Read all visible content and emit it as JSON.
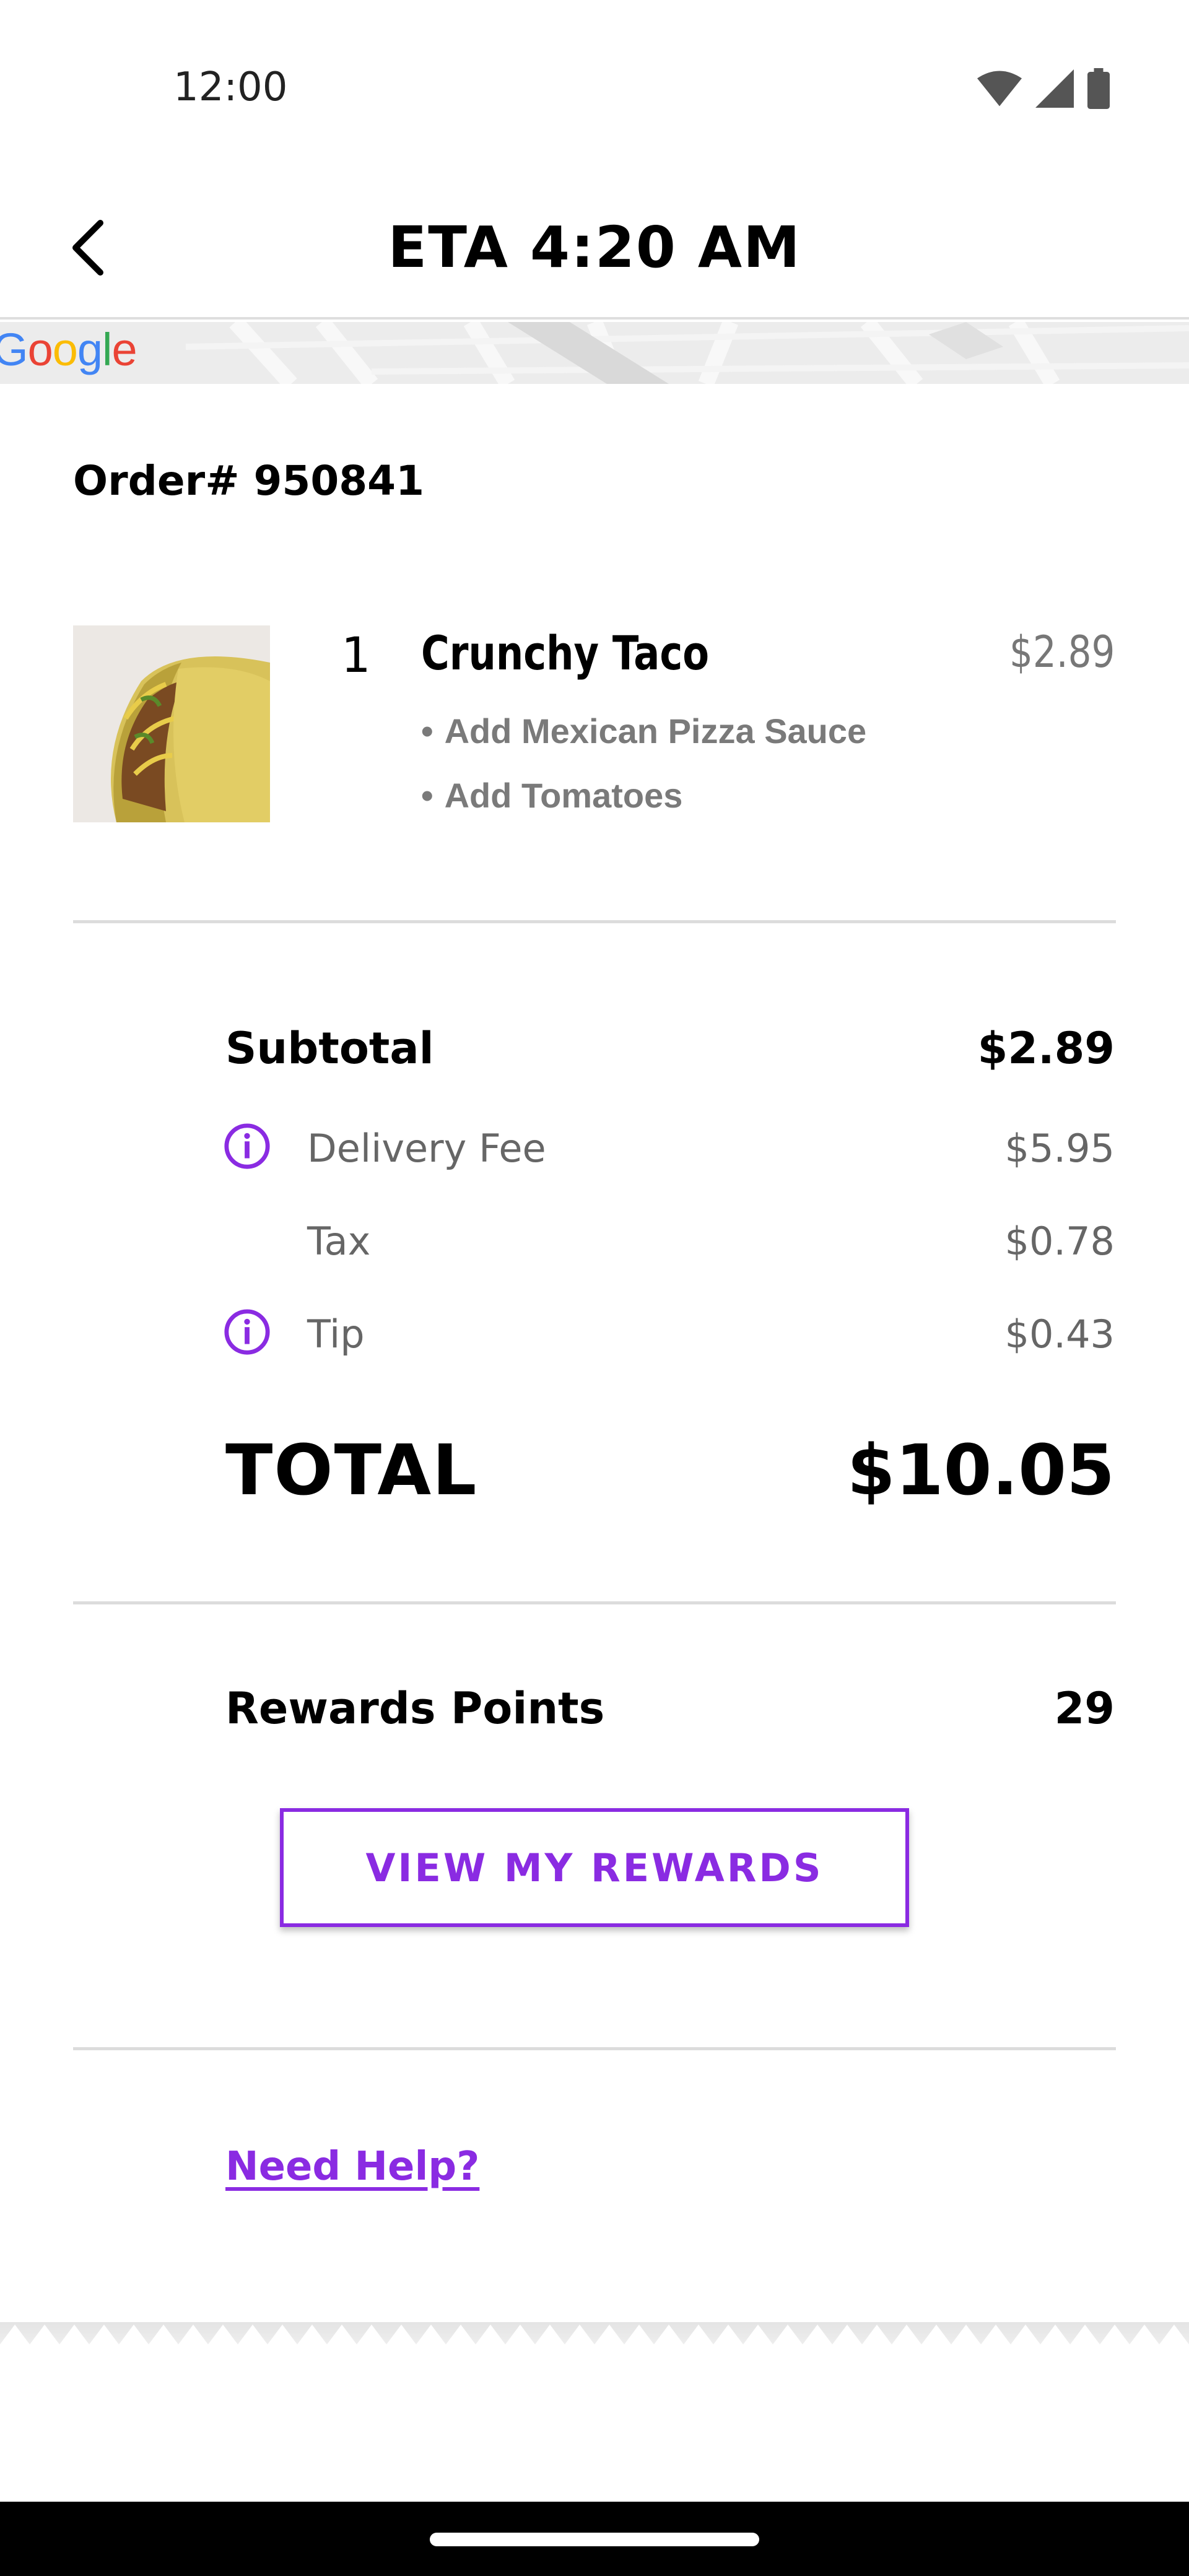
{
  "status_bar": {
    "time": "12:00"
  },
  "header": {
    "title": "ETA 4:20 AM"
  },
  "map": {
    "logo_text": "Google"
  },
  "order": {
    "number_label": "Order# 950841",
    "item": {
      "quantity": "1",
      "name": "Crunchy Taco",
      "price": "$2.89",
      "modifiers": [
        "Add Mexican Pizza Sauce",
        "Add Tomatoes"
      ]
    }
  },
  "summary": {
    "subtotal_label": "Subtotal",
    "subtotal_value": "$2.89",
    "delivery_fee_label": "Delivery Fee",
    "delivery_fee_value": "$5.95",
    "tax_label": "Tax",
    "tax_value": "$0.78",
    "tip_label": "Tip",
    "tip_value": "$0.43",
    "total_label": "TOTAL",
    "total_value": "$10.05"
  },
  "rewards": {
    "points_label": "Rewards Points",
    "points_value": "29",
    "button_label": "VIEW MY REWARDS"
  },
  "help": {
    "link_label": "Need Help?"
  },
  "colors": {
    "accent": "#8a2be2",
    "muted_text": "#777777",
    "divider": "#dcdcdc"
  }
}
